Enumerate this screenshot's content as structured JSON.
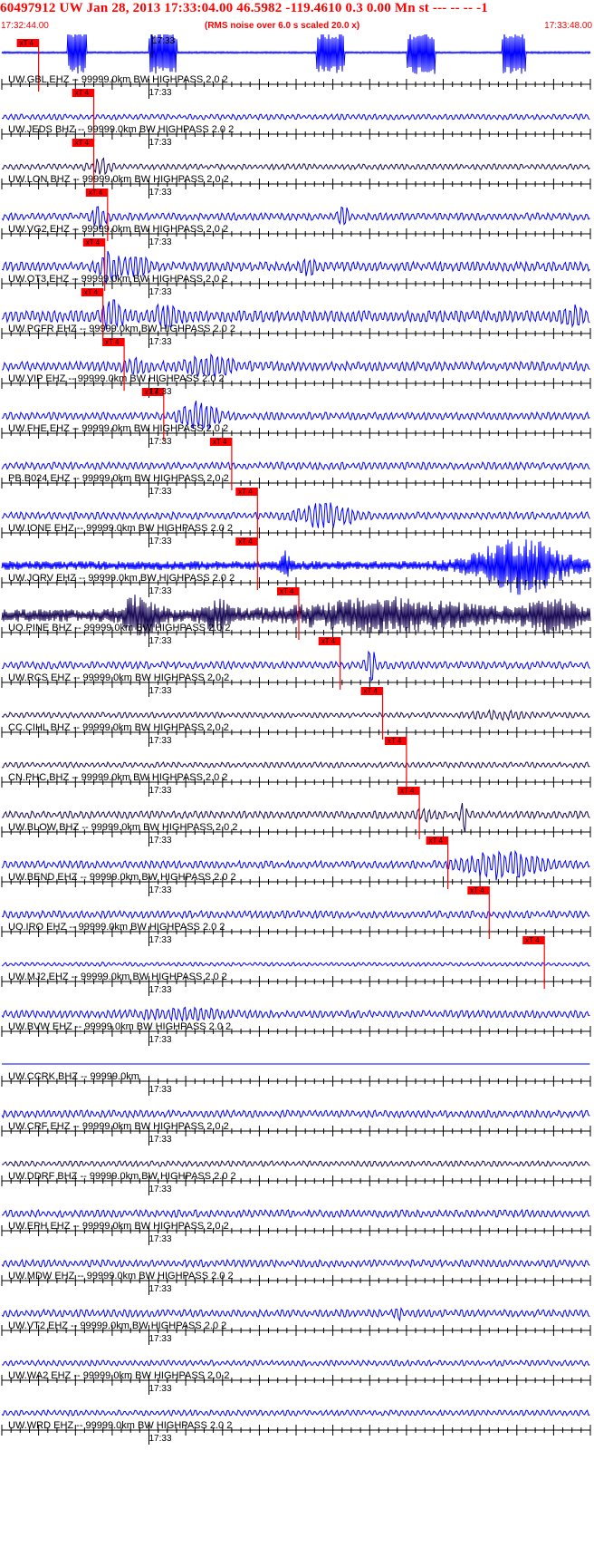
{
  "header": {
    "title": "60497912 UW Jan 28, 2013 17:33:04.00   46.5982 -119.4610  0.3 0.00 Mn st --- -- --  -1",
    "start_time": "17:32:44.00",
    "end_time": "17:33:48.00",
    "rms_note": "(RMS noise over 6.0 s scaled 20.0 x)"
  },
  "colors": {
    "trace_blue": "#0000ff",
    "trace_dark": "#1a0a55",
    "pick_red": "#ff0000",
    "text": "#000000",
    "header_red": "#ff0000"
  },
  "chart_data": {
    "type": "line",
    "title": "60497912 UW Jan 28, 2013 17:33:04.00",
    "x_range": [
      "17:32:44.00",
      "17:33:48.00"
    ],
    "time_tick_label": "17:33",
    "grid": false,
    "pick_label": "xT 4",
    "traces": [
      {
        "name": "UW.GBL EHZ -- 99999.0km BW  HIGHPASS  2.0  2",
        "pick_s": 4.0
      },
      {
        "name": "UW.JEDS BHZ -- 99999.0km BW  HIGHPASS  2.0  2",
        "pick_s": 10.0
      },
      {
        "name": "UW.LON BHZ -- 99999.0km BW  HIGHPASS  2.0  2",
        "pick_s": 10.0
      },
      {
        "name": "UW.VG2 EHZ -- 99999.0km BW  HIGHPASS  2.0  2",
        "pick_s": 11.5
      },
      {
        "name": "UW.OT3 EHZ -- 99999.0km BW  HIGHPASS  2.0  2",
        "pick_s": 11.2
      },
      {
        "name": "UW.PCFR EHZ -- 99999.0km BW  HIGHPASS  2.0  2",
        "pick_s": 11.0
      },
      {
        "name": "UW.VIP EHZ -- 99999.0km BW  HIGHPASS  2.0  2",
        "pick_s": 13.3
      },
      {
        "name": "UW.FHE EHZ -- 99999.0km BW  HIGHPASS  2.0  2",
        "pick_s": 17.6
      },
      {
        "name": "PB.B024 EHZ -- 99999.0km BW  HIGHPASS  2.0  2",
        "pick_s": 25.0
      },
      {
        "name": "UW.IONE EHZ -- 99999.0km BW  HIGHPASS  2.0  2",
        "pick_s": 27.8
      },
      {
        "name": "UW.JORV EHZ -- 99999.0km BW  HIGHPASS  2.0  2",
        "pick_s": 27.8
      },
      {
        "name": "UO.PINE BHZ -- 99999.0km BW  HIGHPASS  2.0  2",
        "pick_s": 32.3
      },
      {
        "name": "UW.RCS EHZ -- 99999.0km BW  HIGHPASS  2.0  2",
        "pick_s": 36.8
      },
      {
        "name": "CC.CIHL BHZ -- 99999.0km BW  HIGHPASS  2.0  2",
        "pick_s": 41.4
      },
      {
        "name": "CN.PHC BHZ -- 99999.0km BW  HIGHPASS  2.0  2",
        "pick_s": 44.0
      },
      {
        "name": "UW.BLOW BHZ -- 99999.0km BW  HIGHPASS  2.0  2",
        "pick_s": 45.4
      },
      {
        "name": "UW.BEND EHZ -- 99999.0km BW  HIGHPASS  2.0  2",
        "pick_s": 48.5
      },
      {
        "name": "UO.IRO EHZ -- 99999.0km BW  HIGHPASS  2.0  2",
        "pick_s": 53.0
      },
      {
        "name": "UW.MJ2 EHZ -- 99999.0km BW  HIGHPASS  2.0  2",
        "pick_s": 59.0
      },
      {
        "name": "UW.BVW EHZ -- 99999.0km BW  HIGHPASS  2.0  2",
        "pick_s": null
      },
      {
        "name": "UW.CCRK BHZ -- 99999.0km",
        "pick_s": null
      },
      {
        "name": "UW.CRF EHZ -- 99999.0km BW  HIGHPASS  2.0  2",
        "pick_s": null
      },
      {
        "name": "UW.DDRF BHZ -- 99999.0km BW  HIGHPASS  2.0  2",
        "pick_s": null
      },
      {
        "name": "UW.EPH EHZ -- 99999.0km BW  HIGHPASS  2.0  2",
        "pick_s": null
      },
      {
        "name": "UW.MDW EHZ -- 99999.0km BW  HIGHPASS  2.0  2",
        "pick_s": null
      },
      {
        "name": "UW.VT2 EHZ -- 99999.0km BW  HIGHPASS  2.0  2",
        "pick_s": null
      },
      {
        "name": "UW.WA2 EHZ -- 99999.0km BW  HIGHPASS  2.0  2",
        "pick_s": null
      },
      {
        "name": "UW.WRD EHZ -- 99999.0km BW  HIGHPASS  2.0  2",
        "pick_s": null
      }
    ]
  }
}
